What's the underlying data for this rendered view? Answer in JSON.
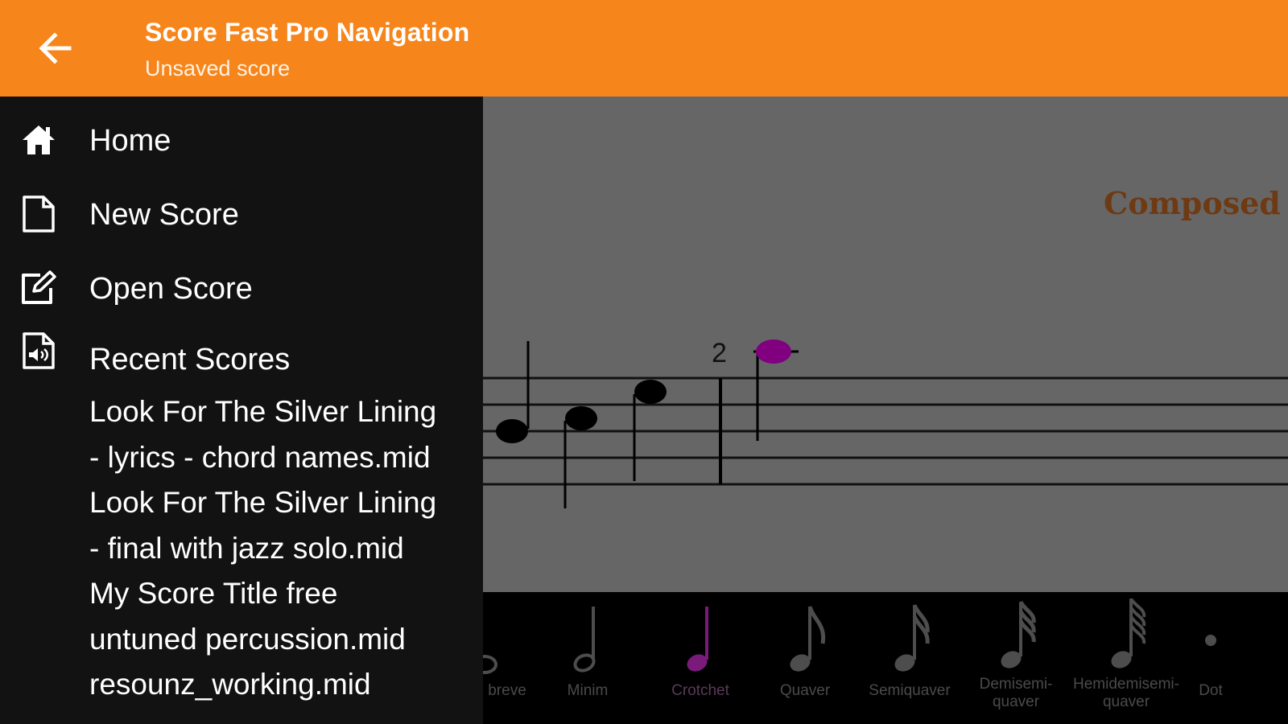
{
  "appbar": {
    "title": "Score Fast Pro Navigation",
    "subtitle": "Unsaved score",
    "back_icon": "arrow-left-icon",
    "color": "#f6861b"
  },
  "drawer": {
    "items": [
      {
        "label": "Home",
        "icon": "home-icon"
      },
      {
        "label": "New Score",
        "icon": "new-file-icon"
      },
      {
        "label": "Open Score",
        "icon": "edit-icon"
      }
    ],
    "recent": {
      "label": "Recent Scores",
      "icon": "audio-file-icon",
      "files": [
        "Look For The Silver Lining\n- lyrics - chord names.mid",
        "Look For The Silver Lining\n- final with jazz solo.mid",
        "My Score Title free\nuntuned percussion.mid",
        "resounz_working.mid"
      ]
    }
  },
  "score": {
    "composer_text": "Composed by I",
    "measure_number": "2",
    "selected_note_color": "#800080"
  },
  "palette": {
    "items": [
      {
        "label": "breve",
        "icon": "breve-icon"
      },
      {
        "label": "Minim",
        "icon": "minim-icon"
      },
      {
        "label": "Crotchet",
        "icon": "crotchet-icon",
        "selected": true
      },
      {
        "label": "Quaver",
        "icon": "quaver-icon"
      },
      {
        "label": "Semiquaver",
        "icon": "semiquaver-icon"
      },
      {
        "label": "Demisemi-\nquaver",
        "icon": "demisemiquaver-icon"
      },
      {
        "label": "Hemidemisemi-\nquaver",
        "icon": "hemidemisemiquaver-icon"
      },
      {
        "label": "Dot",
        "icon": "dot-icon"
      }
    ],
    "selected_color": "#7a1a7a"
  }
}
